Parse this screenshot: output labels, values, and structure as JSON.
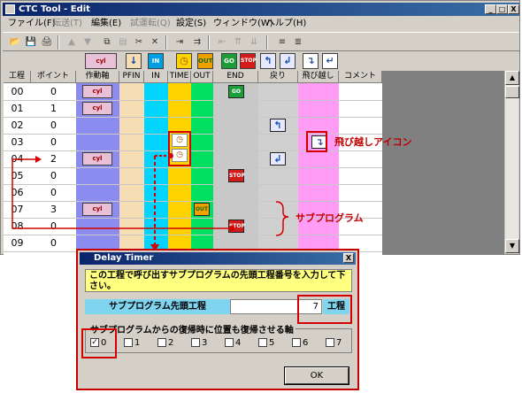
{
  "window": {
    "title": "CTC Tool - Edit",
    "titlebar_buttons": [
      "_",
      "□",
      "X"
    ]
  },
  "menu": [
    {
      "label": "ファイル(F)",
      "enabled": true
    },
    {
      "label": "転送(T)",
      "enabled": false
    },
    {
      "label": "編集(E)",
      "enabled": true
    },
    {
      "label": "試運転(Q)",
      "enabled": false
    },
    {
      "label": "設定(S)",
      "enabled": true
    },
    {
      "label": "ウィンドウ(W)",
      "enabled": true
    },
    {
      "label": "ヘルプ(H)",
      "enabled": true
    }
  ],
  "toolbar_icons": [
    "open-folder-icon",
    "save-icon",
    "print-icon",
    "move-up-icon",
    "move-down-icon",
    "copy-icon",
    "paste-icon",
    "cut-icon",
    "delete-icon",
    "insert-icon",
    "append-icon",
    "step-insert-icon",
    "step-up-icon",
    "step-down-icon",
    "align-icon",
    "align-alt-icon"
  ],
  "iconbar": [
    {
      "name": "cylinder",
      "text": "cyl"
    },
    {
      "name": "pfin",
      "text": "↓"
    },
    {
      "name": "in",
      "text": "IN"
    },
    {
      "name": "timer",
      "text": "◷"
    },
    {
      "name": "out",
      "text": "OUT"
    },
    {
      "name": "go",
      "text": "GO"
    },
    {
      "name": "stop",
      "text": "STOP"
    },
    {
      "name": "return",
      "text": "↰"
    },
    {
      "name": "return2",
      "text": "↲"
    },
    {
      "name": "skip",
      "text": "↴"
    },
    {
      "name": "skip2",
      "text": "↵"
    }
  ],
  "grid": {
    "headers": [
      "工程",
      "ポイント",
      "作動軸",
      "PFIN",
      "IN",
      "TIME",
      "OUT",
      "END",
      "戻り",
      "飛び越し",
      "コメント"
    ],
    "rows": [
      {
        "step": "00",
        "point": "0"
      },
      {
        "step": "01",
        "point": "1"
      },
      {
        "step": "02",
        "point": "0"
      },
      {
        "step": "03",
        "point": "0"
      },
      {
        "step": "04",
        "point": "2"
      },
      {
        "step": "05",
        "point": "0"
      },
      {
        "step": "06",
        "point": "0"
      },
      {
        "step": "07",
        "point": "3"
      },
      {
        "step": "08",
        "point": "0"
      },
      {
        "step": "09",
        "point": "0"
      }
    ],
    "glyph_labels": {
      "go": "GO",
      "stop": "STOP",
      "out": "OUT",
      "cyl": "cyl"
    }
  },
  "annotations": {
    "skip_icon": "飛び越しアイコン",
    "subprogram": "サブプログラム"
  },
  "dialog": {
    "title": "Delay Timer",
    "close_label": "X",
    "message": "この工程で呼び出すサブプログラムの先頭工程番号を入力して下さい。",
    "field_label": "サブプログラム先頭工程",
    "field_value": "7",
    "field_unit": "工程",
    "group_caption": "サブプログラムからの復帰時に位置も復帰させる軸",
    "checkboxes": [
      {
        "label": "0",
        "checked": true
      },
      {
        "label": "1",
        "checked": false
      },
      {
        "label": "2",
        "checked": false
      },
      {
        "label": "3",
        "checked": false
      },
      {
        "label": "4",
        "checked": false
      },
      {
        "label": "5",
        "checked": false
      },
      {
        "label": "6",
        "checked": false
      },
      {
        "label": "7",
        "checked": false
      }
    ],
    "ok_label": "OK"
  },
  "colors": {
    "col_axis": "#8c8cf0",
    "col_pfin": "#f5deb3",
    "col_in": "#00d4ff",
    "col_time": "#ffd200",
    "col_out": "#00e060",
    "col_end": "#c8c8c8",
    "col_return": "#d0d0d0",
    "col_skip": "#ff9cf5",
    "annotation_red": "#d40000"
  }
}
